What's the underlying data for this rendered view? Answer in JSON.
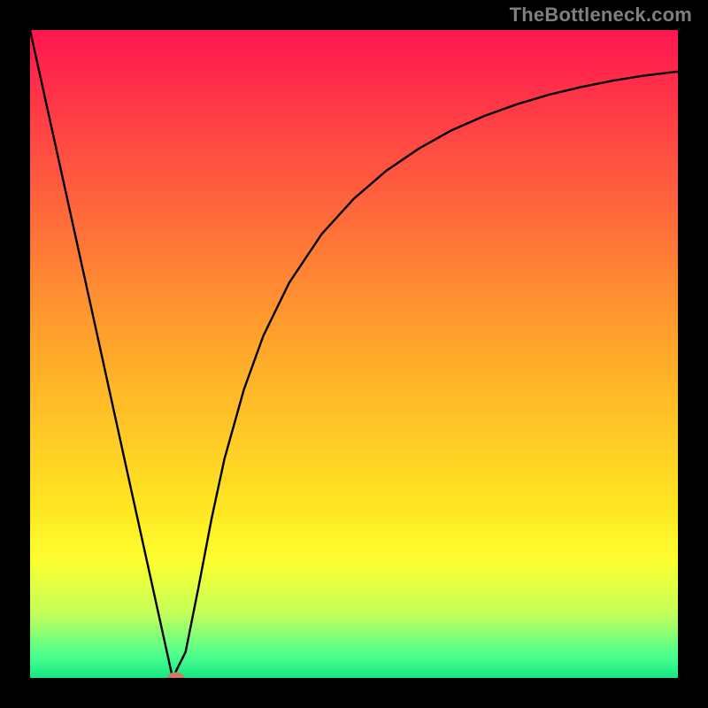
{
  "attribution": "TheBottleneck.com",
  "chart_data": {
    "type": "line",
    "title": "",
    "xlabel": "",
    "ylabel": "",
    "xlim": [
      0,
      100
    ],
    "ylim": [
      0,
      100
    ],
    "background": {
      "type": "vertical_gradient",
      "stops": [
        {
          "offset": 0.0,
          "color": "#ff1650"
        },
        {
          "offset": 0.5,
          "color": "#ffa92a"
        },
        {
          "offset": 0.74,
          "color": "#ffe722"
        },
        {
          "offset": 0.82,
          "color": "#fcff2f"
        },
        {
          "offset": 0.9,
          "color": "#c4ff59"
        },
        {
          "offset": 0.965,
          "color": "#4dff8d"
        },
        {
          "offset": 1.0,
          "color": "#17e884"
        }
      ]
    },
    "series": [
      {
        "name": "bottleneck_curve",
        "color": "#000000",
        "x": [
          0,
          5,
          10,
          15,
          20,
          22,
          24,
          26,
          28,
          30,
          33,
          36,
          40,
          45,
          50,
          55,
          60,
          65,
          70,
          75,
          80,
          85,
          90,
          95,
          100
        ],
        "y": [
          100,
          77.3,
          54.6,
          31.8,
          9.1,
          0,
          4.0,
          14.0,
          24.5,
          33.8,
          44.5,
          52.8,
          61.0,
          68.5,
          74.0,
          78.3,
          81.7,
          84.5,
          86.7,
          88.5,
          90.0,
          91.2,
          92.2,
          93.0,
          93.6
        ]
      }
    ],
    "marker": {
      "name": "optimal_point",
      "x": 22.5,
      "y": 0,
      "color": "#cf7a6a",
      "rx": 1.3,
      "ry": 0.9
    }
  }
}
